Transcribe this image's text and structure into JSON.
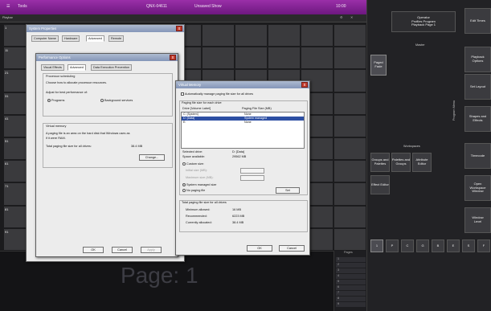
{
  "topbar": {
    "tools_label": "Tools",
    "center_text": "QNX-04611",
    "show_label": "Unsaved Show",
    "right_text": "10:00"
  },
  "subbar": {
    "left_label": "Playbar",
    "right_icons": [
      "settings-icon",
      "close-icon"
    ]
  },
  "grid": {
    "row_numbers": [
      "1",
      "11",
      "21",
      "31",
      "41",
      "51",
      "61",
      "71",
      "81",
      "91"
    ],
    "col_numbers": [
      "3",
      "4",
      "5",
      "6",
      "7",
      "8",
      "9",
      "10",
      "20",
      "30",
      "40",
      "50",
      "60",
      "70",
      "80",
      "90",
      "100"
    ]
  },
  "bottom": {
    "page_label": "Page: 1"
  },
  "pages_panel": {
    "title": "Pages",
    "items": [
      "1",
      "2",
      "3",
      "4",
      "5",
      "6",
      "7",
      "8",
      "9"
    ]
  },
  "right_panel": {
    "operator": "Operator\nProfiles Program\nPlayback Page 1",
    "master_label": "Master",
    "paged_item": "Paged\nFade",
    "workspaces_label": "Workspaces",
    "ws_buttons": [
      "Groups and\nPalettes",
      "Palettes and\nGroups",
      "Attribute\nEditor",
      "Effect Editor"
    ],
    "side_buttons": [
      "Edit Times",
      "Playback\nOptions",
      "Set Layout",
      "Shapes and\nEffects",
      "Timecode",
      "Open\nWorkspace\nWindow",
      "Window\nLevel"
    ],
    "vertical_label": "Program Menu",
    "key_buttons": [
      "1",
      "P",
      "C",
      "G",
      "B",
      "E",
      "S",
      "F"
    ]
  },
  "sysprops": {
    "title": "System Properties",
    "tabs": [
      "Computer Name",
      "Hardware",
      "Advanced",
      "Remote"
    ],
    "close": "x",
    "ok": "OK",
    "cancel": "Cancel",
    "apply": "Apply"
  },
  "perf": {
    "title": "Performance Options",
    "tabs": [
      "Visual Effects",
      "Advanced",
      "Data Execution Prevention"
    ],
    "sched_title": "Processor scheduling",
    "sched_desc": "Choose how to allocate processor resources.",
    "adjust_label": "Adjust for best performance of:",
    "opt_programs": "Programs",
    "opt_background": "Background services",
    "vm_title": "Virtual memory",
    "vm_desc1": "A paging file is an area on the hard disk that Windows uses as",
    "vm_desc2": "if it were RAM.",
    "vm_total_label": "Total paging file size for all drives:",
    "vm_total_value": "38.4 MB",
    "change": "Change...",
    "ok": "OK",
    "cancel": "Cancel",
    "apply": "Apply",
    "close": "x"
  },
  "vmem": {
    "title": "Virtual Memory",
    "auto_label": "Automatically manage paging file size for all drives",
    "group_label": "Paging file size for each drive",
    "col_drive": "Drive  [Volume Label]",
    "col_size": "Paging File Size (MB)",
    "rows": [
      {
        "drive": "C:    [System]",
        "size": "None"
      },
      {
        "drive": "D:    [Data]",
        "size": "System managed"
      },
      {
        "drive": "E:",
        "size": "None"
      }
    ],
    "selected_label": "Selected drive:",
    "selected_value": "D:  [Data]",
    "space_label": "Space available:",
    "space_value": "29562 MB",
    "custom_label": "Custom size:",
    "initial_label": "Initial size (MB):",
    "max_label": "Maximum size (MB):",
    "system_label": "System managed size",
    "nopaging_label": "No paging file",
    "set": "Set",
    "total_group": "Total paging file size for all drives",
    "min_label": "Minimum allowed:",
    "min_value": "16 MB",
    "rec_label": "Recommended:",
    "rec_value": "6223 MB",
    "cur_label": "Currently allocated:",
    "cur_value": "38.4 MB",
    "ok": "OK",
    "cancel": "Cancel",
    "close": "x"
  }
}
